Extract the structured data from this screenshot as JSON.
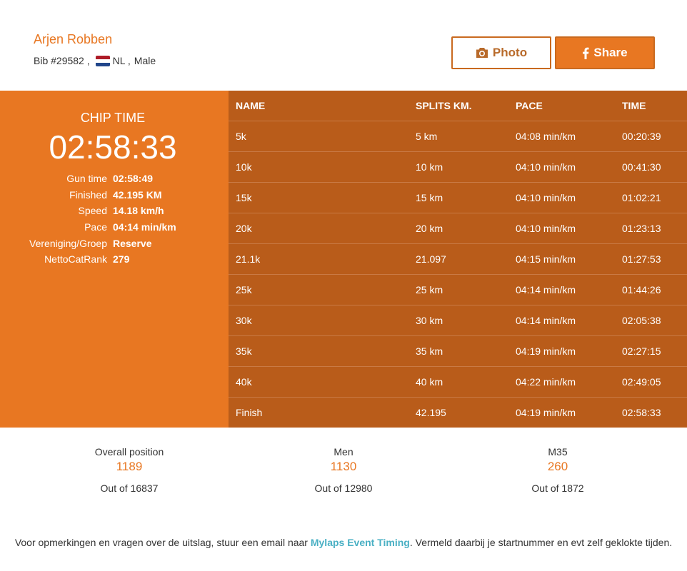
{
  "athlete": {
    "name": "Arjen Robben",
    "bib": "Bib #29582 ,",
    "country": "NL ,",
    "gender": "Male"
  },
  "actions": {
    "photo_label": "Photo",
    "share_label": "Share"
  },
  "summary": {
    "chip_label": "CHIP TIME",
    "chip_time": "02:58:33",
    "stats": [
      {
        "key": "Gun time",
        "value": "02:58:49"
      },
      {
        "key": "Finished",
        "value": "42.195 KM"
      },
      {
        "key": "Speed",
        "value": "14.18 km/h"
      },
      {
        "key": "Pace",
        "value": "04:14 min/km"
      },
      {
        "key": "Vereniging/Groep",
        "value": "Reserve"
      },
      {
        "key": "NettoCatRank",
        "value": "279"
      }
    ]
  },
  "splits": {
    "headers": [
      "NAME",
      "SPLITS KM.",
      "PACE",
      "TIME"
    ],
    "rows": [
      [
        "5k",
        "5 km",
        "04:08 min/km",
        "00:20:39"
      ],
      [
        "10k",
        "10 km",
        "04:10 min/km",
        "00:41:30"
      ],
      [
        "15k",
        "15 km",
        "04:10 min/km",
        "01:02:21"
      ],
      [
        "20k",
        "20 km",
        "04:10 min/km",
        "01:23:13"
      ],
      [
        "21.1k",
        "21.097",
        "04:15 min/km",
        "01:27:53"
      ],
      [
        "25k",
        "25 km",
        "04:14 min/km",
        "01:44:26"
      ],
      [
        "30k",
        "30 km",
        "04:14 min/km",
        "02:05:38"
      ],
      [
        "35k",
        "35 km",
        "04:19 min/km",
        "02:27:15"
      ],
      [
        "40k",
        "40 km",
        "04:22 min/km",
        "02:49:05"
      ],
      [
        "Finish",
        "42.195",
        "04:19 min/km",
        "02:58:33"
      ]
    ]
  },
  "positions": [
    {
      "label": "Overall position",
      "value": "1189",
      "total": "Out of 16837"
    },
    {
      "label": "Men",
      "value": "1130",
      "total": "Out of 12980"
    },
    {
      "label": "M35",
      "value": "260",
      "total": "Out of 1872"
    }
  ],
  "footer": {
    "text_before": "Voor opmerkingen en vragen over de uitslag, stuur een email naar ",
    "link_text": "Mylaps Event Timing",
    "text_after": ". Vermeld daarbij je startnummer en evt zelf geklokte tijden."
  },
  "colors": {
    "accent": "#e87722",
    "table_bg": "#b95c1a",
    "link": "#4ab0c4"
  },
  "icons": {
    "photo": "camera-icon",
    "share": "facebook-icon",
    "flag": "netherlands-flag-icon"
  }
}
